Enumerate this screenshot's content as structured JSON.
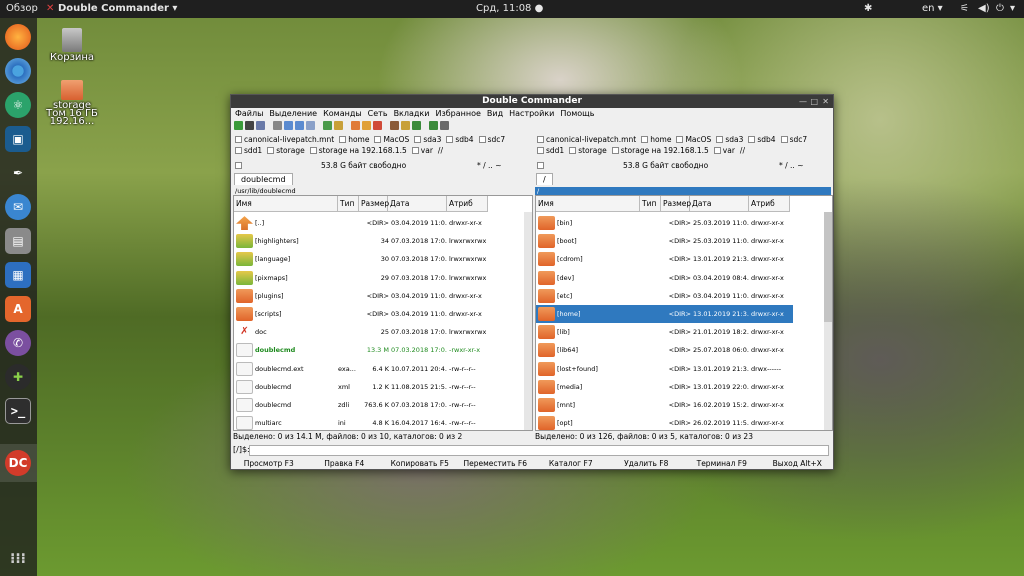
{
  "topbar": {
    "overview": "Обзор",
    "app_name": "Double Commander ▾",
    "clock": "Срд, 11:08 ●",
    "lang": "en ▾"
  },
  "desktop": {
    "trash_label": "Корзина",
    "storage_label": "storage",
    "volume_label": "Том 16 ГБ",
    "network_label": "192.16..."
  },
  "window": {
    "title": "Double Commander",
    "menu": [
      "Файлы",
      "Выделение",
      "Команды",
      "Сеть",
      "Вкладки",
      "Избранное",
      "Вид",
      "Настройки",
      "Помощь"
    ]
  },
  "left": {
    "drives_row1": [
      "canonical-livepatch.mnt",
      "home",
      "MacOS",
      "sda3",
      "sdb4",
      "sdc7"
    ],
    "drives_row2": [
      "sdd1",
      "storage",
      "storage на 192.168.1.5",
      "var",
      "//"
    ],
    "free": "53.8 G байт свободно",
    "nav": "*  /  ..  ~",
    "tab": "doublecmd",
    "path": "/usr/lib/doublecmd",
    "columns": [
      "Имя",
      "Тип",
      "Размер",
      "Дата",
      "Атриб"
    ],
    "rows": [
      {
        "name": "[..]",
        "type": "",
        "size": "<DIR>",
        "date": "03.04.2019 11:0...",
        "attr": "drwxr-xr-x"
      },
      {
        "name": "[highlighters]",
        "type": "",
        "size": "34",
        "date": "07.03.2018 17:0...",
        "attr": "lrwxrwxrwx"
      },
      {
        "name": "[language]",
        "type": "",
        "size": "30",
        "date": "07.03.2018 17:0...",
        "attr": "lrwxrwxrwx"
      },
      {
        "name": "[pixmaps]",
        "type": "",
        "size": "29",
        "date": "07.03.2018 17:0...",
        "attr": "lrwxrwxrwx"
      },
      {
        "name": "[plugins]",
        "type": "",
        "size": "<DIR>",
        "date": "03.04.2019 11:0...",
        "attr": "drwxr-xr-x"
      },
      {
        "name": "[scripts]",
        "type": "",
        "size": "<DIR>",
        "date": "03.04.2019 11:0...",
        "attr": "drwxr-xr-x"
      },
      {
        "name": "doc",
        "type": "",
        "size": "25",
        "date": "07.03.2018 17:0...",
        "attr": "lrwxrwxrwx"
      },
      {
        "name": "doublecmd",
        "type": "",
        "size": "13.3 M",
        "date": "07.03.2018 17:0...",
        "attr": "-rwxr-xr-x"
      },
      {
        "name": "doublecmd.ext",
        "type": "exa...",
        "size": "6.4 K",
        "date": "10.07.2011 20:4...",
        "attr": "-rw-r--r--"
      },
      {
        "name": "doublecmd",
        "type": "xml",
        "size": "1.2 K",
        "date": "11.08.2015 21:5...",
        "attr": "-rw-r--r--"
      },
      {
        "name": "doublecmd",
        "type": "zdli",
        "size": "763.6 K",
        "date": "07.03.2018 17:0...",
        "attr": "-rw-r--r--"
      },
      {
        "name": "multiarc",
        "type": "ini",
        "size": "4.8 K",
        "date": "16.04.2017 16:4...",
        "attr": "-rw-r--r--"
      }
    ],
    "status": "Выделено: 0 из 14.1 M, файлов: 0 из 10, каталогов: 0 из 2"
  },
  "right": {
    "drives_row1": [
      "canonical-livepatch.mnt",
      "home",
      "MacOS",
      "sda3",
      "sdb4",
      "sdc7"
    ],
    "drives_row2": [
      "sdd1",
      "storage",
      "storage на 192.168.1.5",
      "var",
      "//"
    ],
    "free": "53.8 G байт свободно",
    "nav": "*  /  ..  ~",
    "tab": "/",
    "path": "/",
    "columns": [
      "Имя",
      "Тип",
      "Размер",
      "Дата",
      "Атриб"
    ],
    "rows": [
      {
        "name": "[bin]",
        "size": "<DIR>",
        "date": "25.03.2019 11:0...",
        "attr": "drwxr-xr-x"
      },
      {
        "name": "[boot]",
        "size": "<DIR>",
        "date": "25.03.2019 11:0...",
        "attr": "drwxr-xr-x"
      },
      {
        "name": "[cdrom]",
        "size": "<DIR>",
        "date": "13.01.2019 21:3...",
        "attr": "drwxr-xr-x"
      },
      {
        "name": "[dev]",
        "size": "<DIR>",
        "date": "03.04.2019 08:4...",
        "attr": "drwxr-xr-x"
      },
      {
        "name": "[etc]",
        "size": "<DIR>",
        "date": "03.04.2019 11:0...",
        "attr": "drwxr-xr-x"
      },
      {
        "name": "[home]",
        "size": "<DIR>",
        "date": "13.01.2019 21:3...",
        "attr": "drwxr-xr-x"
      },
      {
        "name": "[lib]",
        "size": "<DIR>",
        "date": "21.01.2019 18:2...",
        "attr": "drwxr-xr-x"
      },
      {
        "name": "[lib64]",
        "size": "<DIR>",
        "date": "25.07.2018 06:0...",
        "attr": "drwxr-xr-x"
      },
      {
        "name": "[lost+found]",
        "size": "<DIR>",
        "date": "13.01.2019 21:3...",
        "attr": "drwx------"
      },
      {
        "name": "[media]",
        "size": "<DIR>",
        "date": "13.01.2019 22:0...",
        "attr": "drwxr-xr-x"
      },
      {
        "name": "[mnt]",
        "size": "<DIR>",
        "date": "16.02.2019 15:2...",
        "attr": "drwxr-xr-x"
      },
      {
        "name": "[opt]",
        "size": "<DIR>",
        "date": "26.02.2019 11:5...",
        "attr": "drwxr-xr-x"
      }
    ],
    "status": "Выделено: 0 из 126, файлов: 0 из 5, каталогов: 0 из 23"
  },
  "cmdline": {
    "prompt": "[/]$:"
  },
  "fkeys": [
    "Просмотр F3",
    "Правка F4",
    "Копировать F5",
    "Переместить F6",
    "Каталог F7",
    "Удалить F8",
    "Терминал F9",
    "Выход Alt+X"
  ],
  "colors": {
    "selection": "#2f79bf",
    "folder": "#e8743a",
    "executable": "#1e8a1e"
  }
}
